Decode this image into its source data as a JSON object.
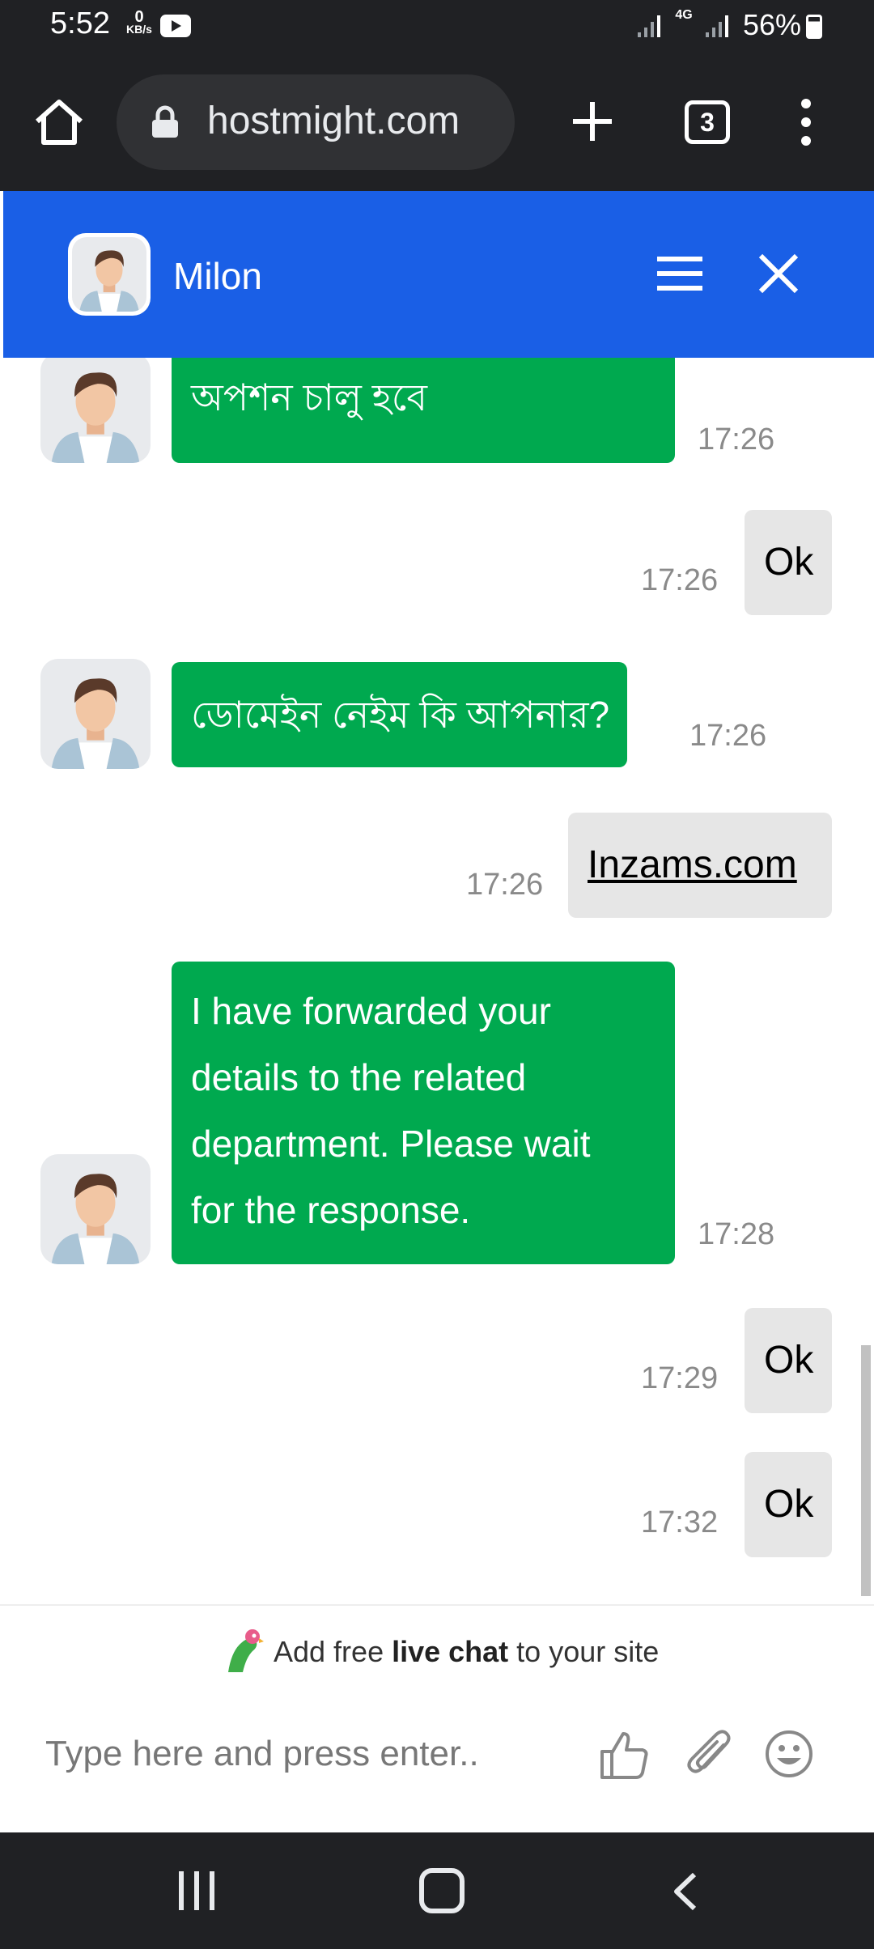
{
  "status_bar": {
    "time": "5:52",
    "net_speed_value": "0",
    "net_speed_unit": "KB/s",
    "network_type": "4G",
    "battery": "56%",
    "icons": [
      "youtube-icon",
      "signal-icon",
      "battery-icon"
    ]
  },
  "browser": {
    "url": "hostmight.com",
    "tab_count": "3",
    "icons": [
      "home-icon",
      "lock-icon",
      "plus-icon",
      "tabs-icon",
      "more-icon"
    ]
  },
  "chat": {
    "header": {
      "agent_name": "Milon",
      "icons": [
        "menu-icon",
        "close-icon"
      ]
    },
    "colors": {
      "header": "#1a5fe6",
      "agent_bubble": "#00a94f",
      "user_bubble": "#e6e6e6"
    },
    "messages": [
      {
        "from": "agent",
        "text": "অপশন চালু হবে",
        "time": "17:26"
      },
      {
        "from": "user",
        "text": "Ok",
        "time": "17:26"
      },
      {
        "from": "agent",
        "text": "ডোমেইন নেইম কি আপনার?",
        "time": "17:26"
      },
      {
        "from": "user",
        "text": "Inzams.com",
        "time": "17:26"
      },
      {
        "from": "agent",
        "lines": [
          "I have forwarded your",
          "details to the related",
          "department. Please wait",
          "for the response."
        ],
        "time": "17:28"
      },
      {
        "from": "user",
        "text": "Ok",
        "time": "17:29"
      },
      {
        "from": "user",
        "text": "Ok",
        "time": "17:32"
      }
    ],
    "promo": {
      "prefix": "Add free ",
      "bold": "live chat",
      "suffix": " to your site"
    },
    "composer": {
      "placeholder": "Type here and press enter..",
      "icons": [
        "thumbs-up-icon",
        "paperclip-icon",
        "emoji-icon"
      ]
    }
  },
  "nav_bar": {
    "icons": [
      "recents-icon",
      "home-nav-icon",
      "back-icon"
    ]
  }
}
